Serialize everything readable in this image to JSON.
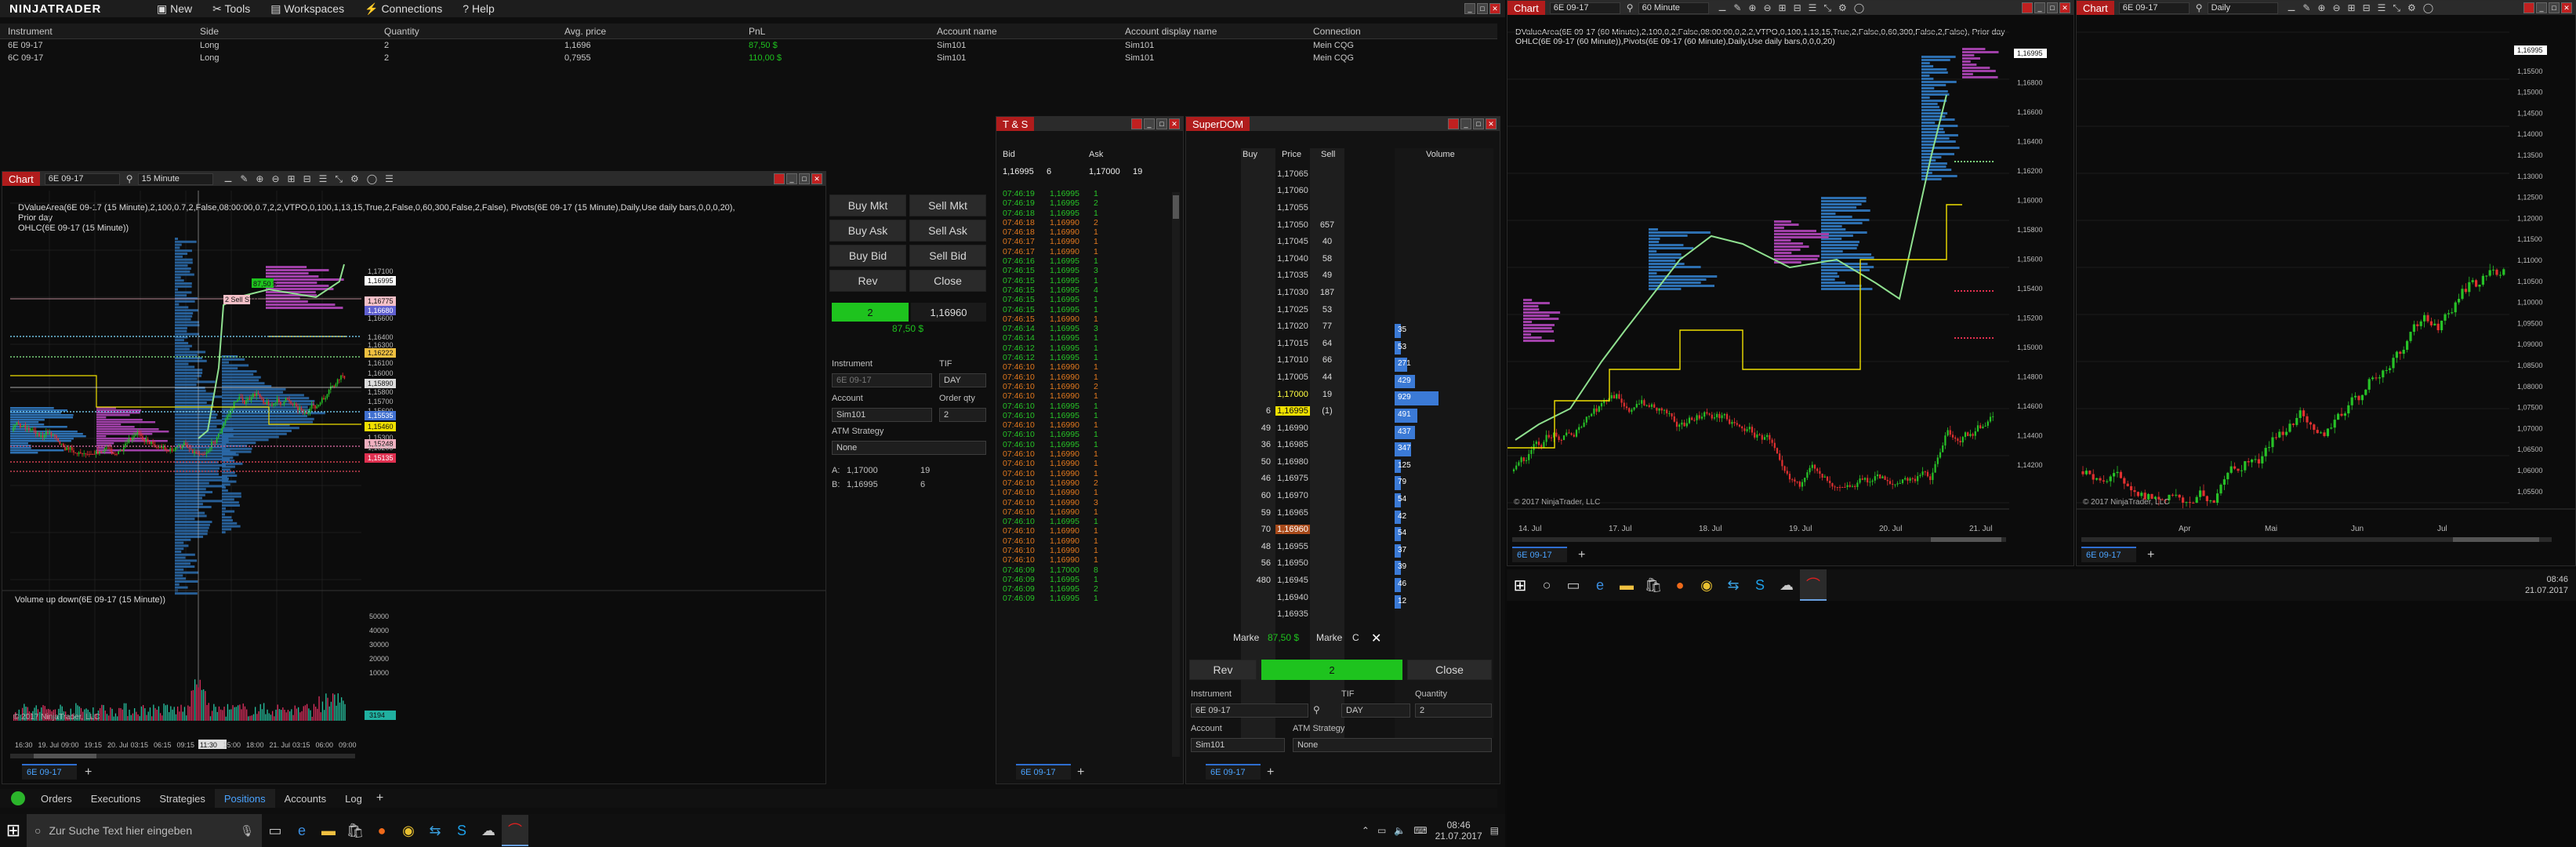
{
  "control_center": {
    "logo": "NINJATRADER",
    "menu": [
      "New",
      "Tools",
      "Workspaces",
      "Connections",
      "Help"
    ],
    "positions_headers": [
      "Instrument",
      "Side",
      "Quantity",
      "Avg. price",
      "PnL",
      "Account name",
      "Account display name",
      "Connection"
    ],
    "positions_rows": [
      [
        "6E 09-17",
        "Long",
        "2",
        "1,1696",
        "87,50 $",
        "Sim101",
        "Sim101",
        "Mein CQG"
      ],
      [
        "6C 09-17",
        "Long",
        "2",
        "0,7955",
        "110,00 $",
        "Sim101",
        "Sim101",
        "Mein CQG"
      ]
    ],
    "bottom_tabs": [
      "Orders",
      "Executions",
      "Strategies",
      "Positions",
      "Accounts",
      "Log"
    ],
    "active_bottom_tab": "Positions"
  },
  "chart1": {
    "title": "Chart",
    "instrument": "6E 09-17",
    "interval": "15 Minute",
    "indicator_line1": "DValueArea(6E 09-17 (15 Minute),2,100,0.7,2,False,08:00:00,0.7,2,2,VTPO,0,100,1,13,15,True,2,False,0,60,300,False,2,False), Pivots(6E 09-17 (15 Minute),Daily,Use daily bars,0,0,0,20), Prior day",
    "indicator_line2": "OHLC(6E 09-17 (15 Minute))",
    "price_labels": [
      "1,17100",
      "1,16995",
      "1,16775",
      "1,16680",
      "1,16600",
      "1,16400",
      "1,16300",
      "1,16222",
      "1,16100",
      "1,16000",
      "1,15890",
      "1,15800",
      "1,15700",
      "1,15600",
      "1,15535",
      "1,15460",
      "1,15300",
      "1,15248",
      "1,15200",
      "1,15135"
    ],
    "order_labels": {
      "pnl": "87,50 $",
      "qty": "2",
      "stop": "2 Sell STP"
    },
    "sub_panel_title": "Volume up down(6E 09-17 (15 Minute))",
    "vol_labels": [
      "50000",
      "40000",
      "30000",
      "20000",
      "10000",
      "3194"
    ],
    "time_labels": [
      "16:30",
      "19. Jul",
      "09:00",
      "19:15",
      "20. Jul",
      "03:15",
      "06:15",
      "09:15",
      "11:30",
      "15:00",
      "18:00",
      "21. Jul",
      "03:15",
      "06:00",
      "09:00"
    ],
    "copyright": "© 2017 NinjaTrader, LLC",
    "tab": "6E 09-17",
    "chart_trader": {
      "buttons": [
        "Buy Mkt",
        "Sell Mkt",
        "Buy Ask",
        "Sell Ask",
        "Buy Bid",
        "Sell Bid",
        "Rev",
        "Close"
      ],
      "position_qty": "2",
      "position_price": "1,16960",
      "position_pnl": "87,50 $",
      "instrument_label": "Instrument",
      "instrument": "6E 09-17",
      "tif_label": "TIF",
      "tif": "DAY",
      "account_label": "Account",
      "account": "Sim101",
      "qty_label": "Order qty",
      "qty": "2",
      "atm_label": "ATM Strategy",
      "atm": "None",
      "ask_label": "A:",
      "ask": "1,17000",
      "ask_size": "19",
      "bid_label": "B:",
      "bid": "1,16995",
      "bid_size": "6"
    }
  },
  "ts": {
    "title": "T & S",
    "headers": [
      "Bid",
      "Ask",
      ""
    ],
    "top": [
      "1,16995",
      "6",
      "1,17000",
      "19"
    ],
    "rows": [
      [
        "07:46:19",
        "1,16995",
        "1",
        "g"
      ],
      [
        "07:46:19",
        "1,16995",
        "2",
        "g"
      ],
      [
        "07:46:18",
        "1,16995",
        "1",
        "g"
      ],
      [
        "07:46:18",
        "1,16990",
        "2",
        "o"
      ],
      [
        "07:46:18",
        "1,16990",
        "1",
        "o"
      ],
      [
        "07:46:17",
        "1,16990",
        "1",
        "o"
      ],
      [
        "07:46:17",
        "1,16990",
        "1",
        "o"
      ],
      [
        "07:46:16",
        "1,16995",
        "1",
        "g"
      ],
      [
        "07:46:15",
        "1,16995",
        "3",
        "g"
      ],
      [
        "07:46:15",
        "1,16995",
        "1",
        "g"
      ],
      [
        "07:46:15",
        "1,16995",
        "4",
        "g"
      ],
      [
        "07:46:15",
        "1,16995",
        "1",
        "g"
      ],
      [
        "07:46:15",
        "1,16995",
        "1",
        "g"
      ],
      [
        "07:46:15",
        "1,16990",
        "1",
        "o"
      ],
      [
        "07:46:14",
        "1,16995",
        "3",
        "g"
      ],
      [
        "07:46:14",
        "1,16995",
        "1",
        "g"
      ],
      [
        "07:46:12",
        "1,16995",
        "1",
        "g"
      ],
      [
        "07:46:12",
        "1,16995",
        "1",
        "g"
      ],
      [
        "07:46:10",
        "1,16990",
        "1",
        "o"
      ],
      [
        "07:46:10",
        "1,16990",
        "1",
        "o"
      ],
      [
        "07:46:10",
        "1,16990",
        "2",
        "o"
      ],
      [
        "07:46:10",
        "1,16990",
        "1",
        "o"
      ],
      [
        "07:46:10",
        "1,16995",
        "1",
        "g"
      ],
      [
        "07:46:10",
        "1,16995",
        "1",
        "g"
      ],
      [
        "07:46:10",
        "1,16990",
        "1",
        "o"
      ],
      [
        "07:46:10",
        "1,16995",
        "1",
        "g"
      ],
      [
        "07:46:10",
        "1,16995",
        "1",
        "g"
      ],
      [
        "07:46:10",
        "1,16990",
        "1",
        "o"
      ],
      [
        "07:46:10",
        "1,16990",
        "1",
        "o"
      ],
      [
        "07:46:10",
        "1,16990",
        "1",
        "o"
      ],
      [
        "07:46:10",
        "1,16990",
        "2",
        "o"
      ],
      [
        "07:46:10",
        "1,16990",
        "1",
        "o"
      ],
      [
        "07:46:10",
        "1,16990",
        "3",
        "o"
      ],
      [
        "07:46:10",
        "1,16990",
        "1",
        "o"
      ],
      [
        "07:46:10",
        "1,16995",
        "1",
        "g"
      ],
      [
        "07:46:10",
        "1,16990",
        "1",
        "o"
      ],
      [
        "07:46:10",
        "1,16990",
        "1",
        "o"
      ],
      [
        "07:46:10",
        "1,16990",
        "1",
        "o"
      ],
      [
        "07:46:10",
        "1,16990",
        "1",
        "o"
      ],
      [
        "07:46:09",
        "1,17000",
        "8",
        "g"
      ],
      [
        "07:46:09",
        "1,16995",
        "1",
        "g"
      ],
      [
        "07:46:09",
        "1,16995",
        "2",
        "g"
      ],
      [
        "07:46:09",
        "1,16995",
        "1",
        "g"
      ]
    ],
    "tab": "6E 09-17"
  },
  "superdom": {
    "title": "SuperDOM",
    "headers": [
      "Buy",
      "Price",
      "Sell",
      "Volume"
    ],
    "ladder": [
      [
        "",
        "1,17065",
        ""
      ],
      [
        "",
        "1,17060",
        ""
      ],
      [
        "",
        "1,17055",
        ""
      ],
      [
        "",
        "1,17050",
        "657"
      ],
      [
        "",
        "1,17045",
        "40"
      ],
      [
        "",
        "1,17040",
        "58"
      ],
      [
        "",
        "1,17035",
        "49"
      ],
      [
        "",
        "1,17030",
        "187"
      ],
      [
        "",
        "1,17025",
        "53"
      ],
      [
        "",
        "1,17020",
        "77"
      ],
      [
        "",
        "1,17015",
        "64"
      ],
      [
        "",
        "1,17010",
        "66"
      ],
      [
        "",
        "1,17005",
        "44"
      ],
      [
        "",
        "1,17000",
        "19"
      ],
      [
        "6",
        "1,16995",
        "(1)"
      ],
      [
        "49",
        "1,16990",
        ""
      ],
      [
        "36",
        "1,16985",
        ""
      ],
      [
        "50",
        "1,16980",
        ""
      ],
      [
        "46",
        "1,16975",
        ""
      ],
      [
        "60",
        "1,16970",
        ""
      ],
      [
        "59",
        "1,16965",
        ""
      ],
      [
        "70",
        "1,16960",
        ""
      ],
      [
        "48",
        "1,16955",
        ""
      ],
      [
        "56",
        "1,16950",
        ""
      ],
      [
        "480",
        "1,16945",
        ""
      ],
      [
        "",
        "1,16940",
        ""
      ],
      [
        "",
        "1,16935",
        ""
      ]
    ],
    "volumes": [
      "35",
      "53",
      "271",
      "429",
      "929",
      "491",
      "437",
      "347",
      "125",
      "79",
      "54",
      "42",
      "54",
      "37",
      "39",
      "46",
      "12"
    ],
    "market_label": "Marke",
    "pnl": "87,50 $",
    "close_x": "C",
    "rev": "Rev",
    "pos_qty": "2",
    "close": "Close",
    "instrument_label": "Instrument",
    "instrument": "6E 09-17",
    "tif_label": "TIF",
    "tif": "DAY",
    "qty_label": "Quantity",
    "qty": "2",
    "account_label": "Account",
    "account": "Sim101",
    "atm_label": "ATM Strategy",
    "atm": "None",
    "tab": "6E 09-17"
  },
  "chart2": {
    "title": "Chart",
    "instrument": "6E 09-17",
    "interval": "60 Minute",
    "indicator_line1": "DValueArea(6E 09-17 (60 Minute),2,100,0,2,False,08:00:00,0,2,2,VTPO,0,100,1,13,15,True,2,False,0,60,300,False,2,False), Prior day",
    "indicator_line2": "OHLC(6E 09-17 (60 Minute)),Pivots(6E 09-17 (60 Minute),Daily,Use daily bars,0,0,0,20)",
    "price_labels": [
      "1,16995",
      "1,16800",
      "1,16600",
      "1,16400",
      "1,16200",
      "1,16000",
      "1,15800",
      "1,15600",
      "1,15400",
      "1,15200",
      "1,15000",
      "1,14800",
      "1,14600",
      "1,14400",
      "1,14200"
    ],
    "time_labels": [
      "14. Jul",
      "17. Jul",
      "18. Jul",
      "19. Jul",
      "20. Jul",
      "21. Jul"
    ],
    "copyright": "© 2017 NinjaTrader, LLC",
    "tab": "6E 09-17"
  },
  "chart3": {
    "title": "Chart",
    "instrument": "6E 09-17",
    "interval": "Daily",
    "price_labels": [
      "1,16995",
      "1,15500",
      "1,15000",
      "1,14500",
      "1,14000",
      "1,13500",
      "1,13000",
      "1,12500",
      "1,12000",
      "1,11500",
      "1,11000",
      "1,10500",
      "1,10000",
      "1,09500",
      "1,09000",
      "1,08500",
      "1,08000",
      "1,07500",
      "1,07000",
      "1,06500",
      "1,06000",
      "1,05500"
    ],
    "time_labels": [
      "Apr",
      "Mai",
      "Jun",
      "Jul"
    ],
    "copyright": "© 2017 NinjaTrader, LLC",
    "tab": "6E 09-17"
  },
  "taskbar_left": {
    "search_placeholder": "Zur Suche Text hier eingeben",
    "time": "08:46",
    "date": "21.07.2017"
  },
  "taskbar_right": {
    "time": "08:46",
    "date": "21.07.2017"
  },
  "colors": {
    "accent_red": "#b01c1c",
    "green": "#1ec31e",
    "blue_profile": "#2d6fb0",
    "magenta": "#b040b0",
    "yellow": "#f0e000"
  }
}
